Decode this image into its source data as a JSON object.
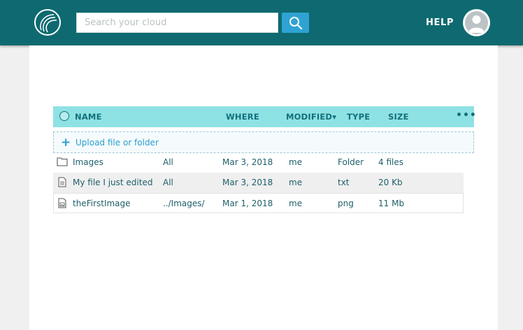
{
  "header": {
    "search_placeholder": "Search your cloud",
    "help_label": "HELP"
  },
  "table": {
    "columns": {
      "name": "NAME",
      "where": "WHERE",
      "modified": "MODIFIED",
      "modified_sort_indicator": "▾",
      "type": "TYPE",
      "size": "SIZE",
      "more": "•••"
    },
    "upload_label": "Upload file or folder",
    "rows": [
      {
        "icon": "folder-icon",
        "name": "Images",
        "where": "All",
        "date": "Mar 3, 2018",
        "by": "me",
        "type": "Folder",
        "size": "4 files"
      },
      {
        "icon": "document-icon",
        "name": "My file I just edited",
        "where": "All",
        "date": "Mar 3, 2018",
        "by": "me",
        "type": "txt",
        "size": "20 Kb"
      },
      {
        "icon": "image-file-icon",
        "name": "theFirstImage",
        "where": "../Images/",
        "date": "Mar 1, 2018",
        "by": "me",
        "type": "png",
        "size": "11 Mb"
      }
    ]
  },
  "colors": {
    "header_bg": "#0e6a70",
    "table_header_bg": "#8fe2e4",
    "accent": "#2ea3d3"
  }
}
